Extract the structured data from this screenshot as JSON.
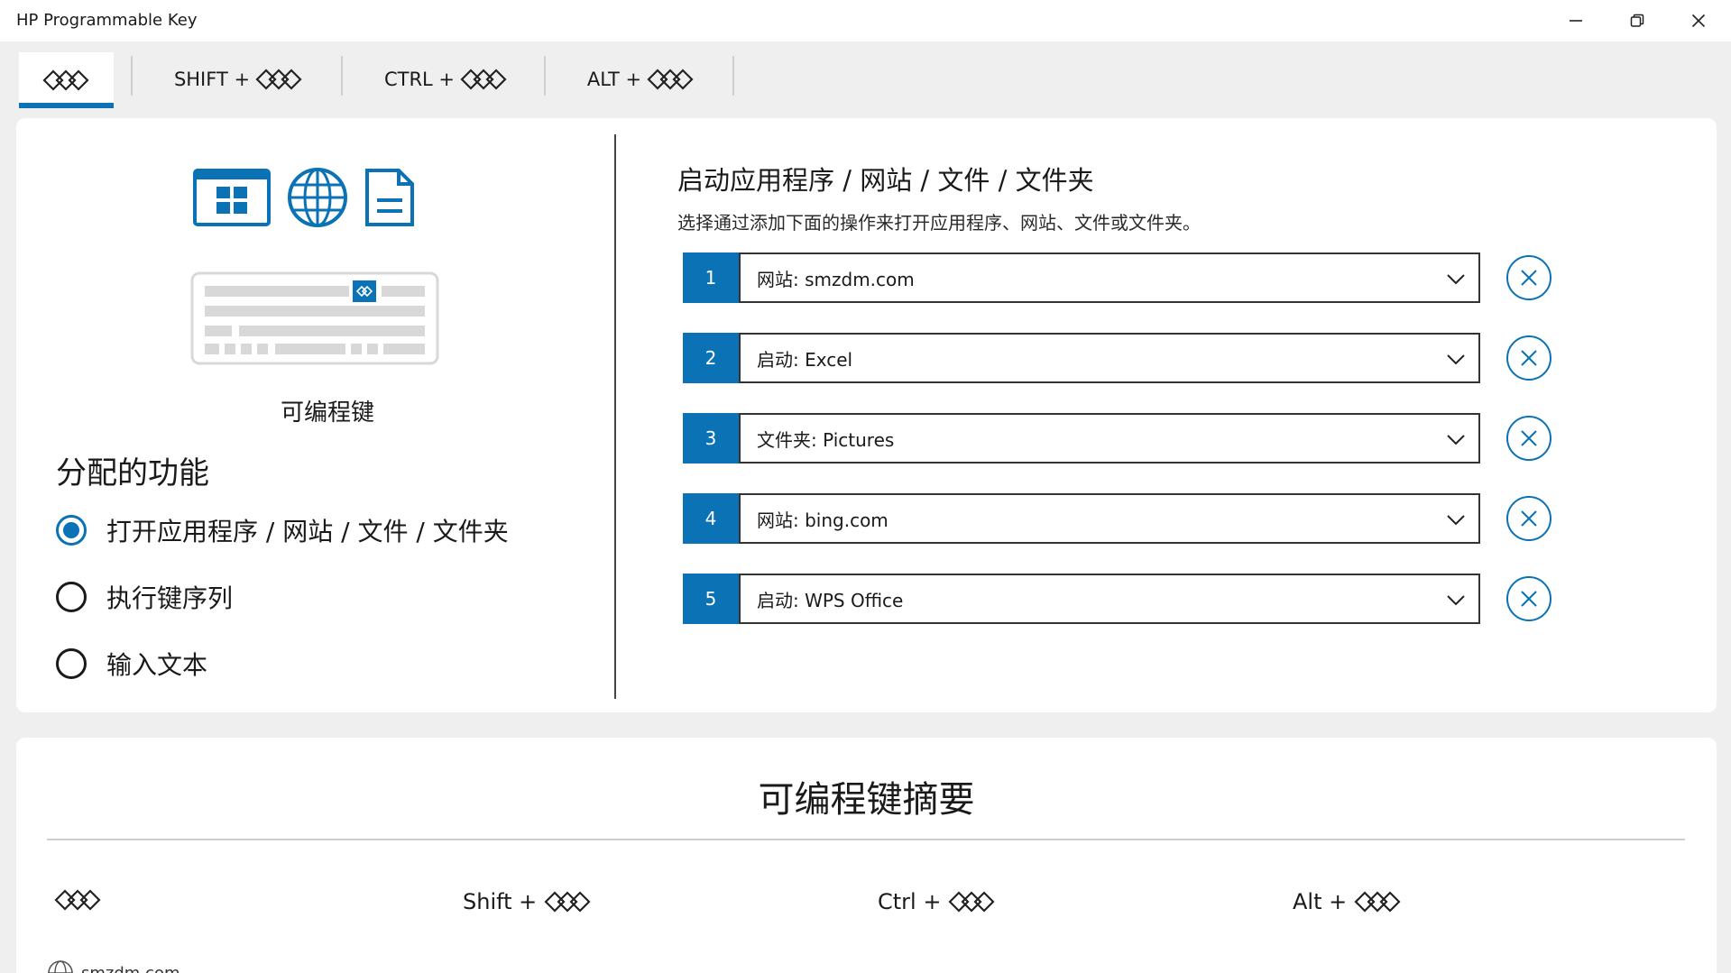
{
  "window": {
    "title": "HP Programmable Key",
    "icons": {
      "minimize": "minimize-icon",
      "maximize": "restore-icon",
      "close": "close-icon"
    }
  },
  "tabs": [
    {
      "label": "",
      "icon": "hp-key-icon",
      "active": true
    },
    {
      "label": "SHIFT +",
      "icon": "hp-key-icon",
      "active": false
    },
    {
      "label": "CTRL +",
      "icon": "hp-key-icon",
      "active": false
    },
    {
      "label": "ALT +",
      "icon": "hp-key-icon",
      "active": false
    }
  ],
  "left_panel": {
    "feature_icons": [
      "app-window-icon",
      "globe-icon",
      "document-icon"
    ],
    "key_caption": "可编程键",
    "section_title": "分配的功能",
    "options": [
      {
        "label": "打开应用程序 / 网站 / 文件 / 文件夹",
        "checked": true
      },
      {
        "label": "执行键序列",
        "checked": false
      },
      {
        "label": "输入文本",
        "checked": false
      }
    ]
  },
  "right_panel": {
    "title": "启动应用程序 / 网站 / 文件 / 文件夹",
    "description": "选择通过添加下面的操作来打开应用程序、网站、文件或文件夹。",
    "actions": [
      {
        "number": "1",
        "value": "网站: smzdm.com"
      },
      {
        "number": "2",
        "value": "启动: Excel"
      },
      {
        "number": "3",
        "value": "文件夹: Pictures"
      },
      {
        "number": "4",
        "value": "网站: bing.com"
      },
      {
        "number": "5",
        "value": "启动: WPS Office"
      }
    ]
  },
  "summary": {
    "title": "可编程键摘要",
    "columns": [
      {
        "label": ""
      },
      {
        "label": "Shift +"
      },
      {
        "label": "Ctrl +"
      },
      {
        "label": "Alt +"
      }
    ],
    "first_entry": "smzdm.com"
  },
  "colors": {
    "accent": "#0a72b5"
  }
}
